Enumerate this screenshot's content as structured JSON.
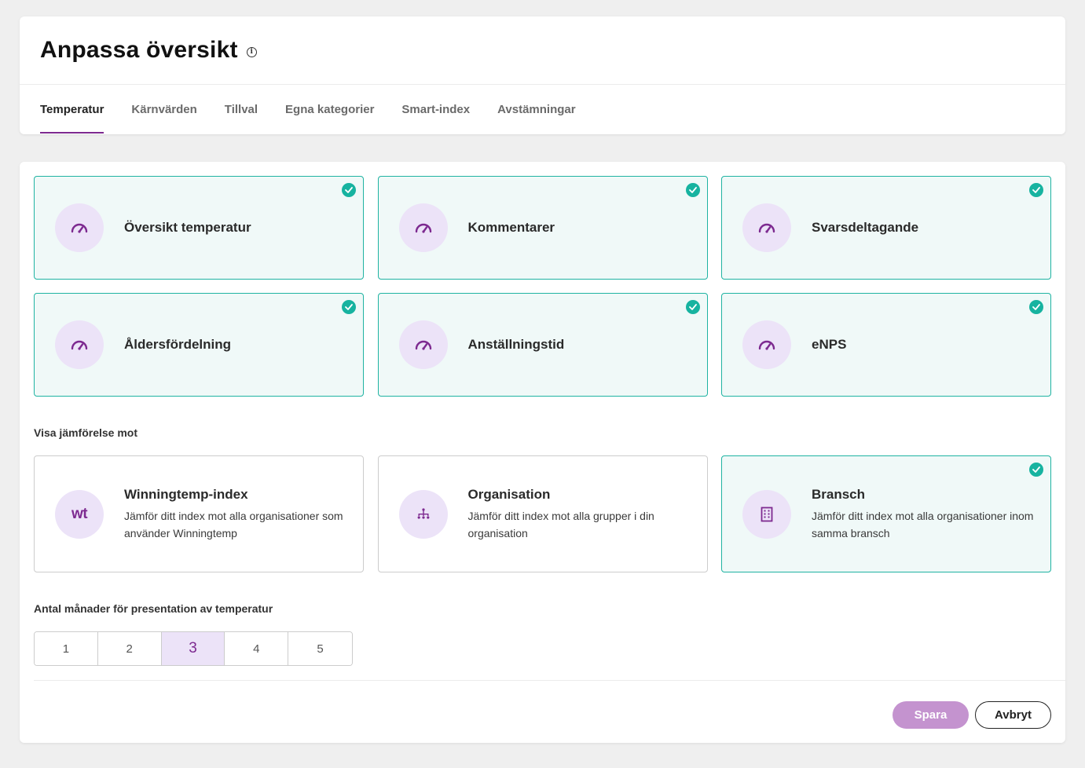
{
  "header": {
    "title": "Anpassa översikt",
    "info_icon": "info-icon"
  },
  "tabs": [
    {
      "label": "Temperatur",
      "active": true
    },
    {
      "label": "Kärnvärden",
      "active": false
    },
    {
      "label": "Tillval",
      "active": false
    },
    {
      "label": "Egna kategorier",
      "active": false
    },
    {
      "label": "Smart-index",
      "active": false
    },
    {
      "label": "Avstämningar",
      "active": false
    }
  ],
  "widgets": [
    {
      "label": "Översikt temperatur",
      "icon": "gauge-icon",
      "selected": true
    },
    {
      "label": "Kommentarer",
      "icon": "gauge-icon",
      "selected": true
    },
    {
      "label": "Svarsdeltagande",
      "icon": "gauge-icon",
      "selected": true
    },
    {
      "label": "Åldersfördelning",
      "icon": "gauge-icon",
      "selected": true
    },
    {
      "label": "Anställningstid",
      "icon": "gauge-icon",
      "selected": true
    },
    {
      "label": "eNPS",
      "icon": "gauge-icon",
      "selected": true
    }
  ],
  "comparison": {
    "label": "Visa jämförelse mot",
    "options": [
      {
        "title": "Winningtemp-index",
        "description": "Jämför ditt index mot alla organisationer som använder Winningtemp",
        "icon_text": "wt",
        "selected": false
      },
      {
        "title": "Organisation",
        "description": "Jämför ditt index mot alla grupper i din organisation",
        "icon": "org-tree-icon",
        "selected": false
      },
      {
        "title": "Bransch",
        "description": "Jämför ditt index mot alla organisationer inom samma bransch",
        "icon": "building-icon",
        "selected": true
      }
    ]
  },
  "months": {
    "label": "Antal månader för presentation av temperatur",
    "options": [
      "1",
      "2",
      "3",
      "4",
      "5"
    ],
    "selected": "3"
  },
  "actions": {
    "save_label": "Spara",
    "cancel_label": "Avbryt"
  },
  "colors": {
    "accent": "#7d2a90",
    "selected_border": "#1fb3a2",
    "selected_bg": "#f0f9f8",
    "check": "#17b3a0",
    "icon_bg": "#ece3f8",
    "save_bg": "#c493cf"
  }
}
